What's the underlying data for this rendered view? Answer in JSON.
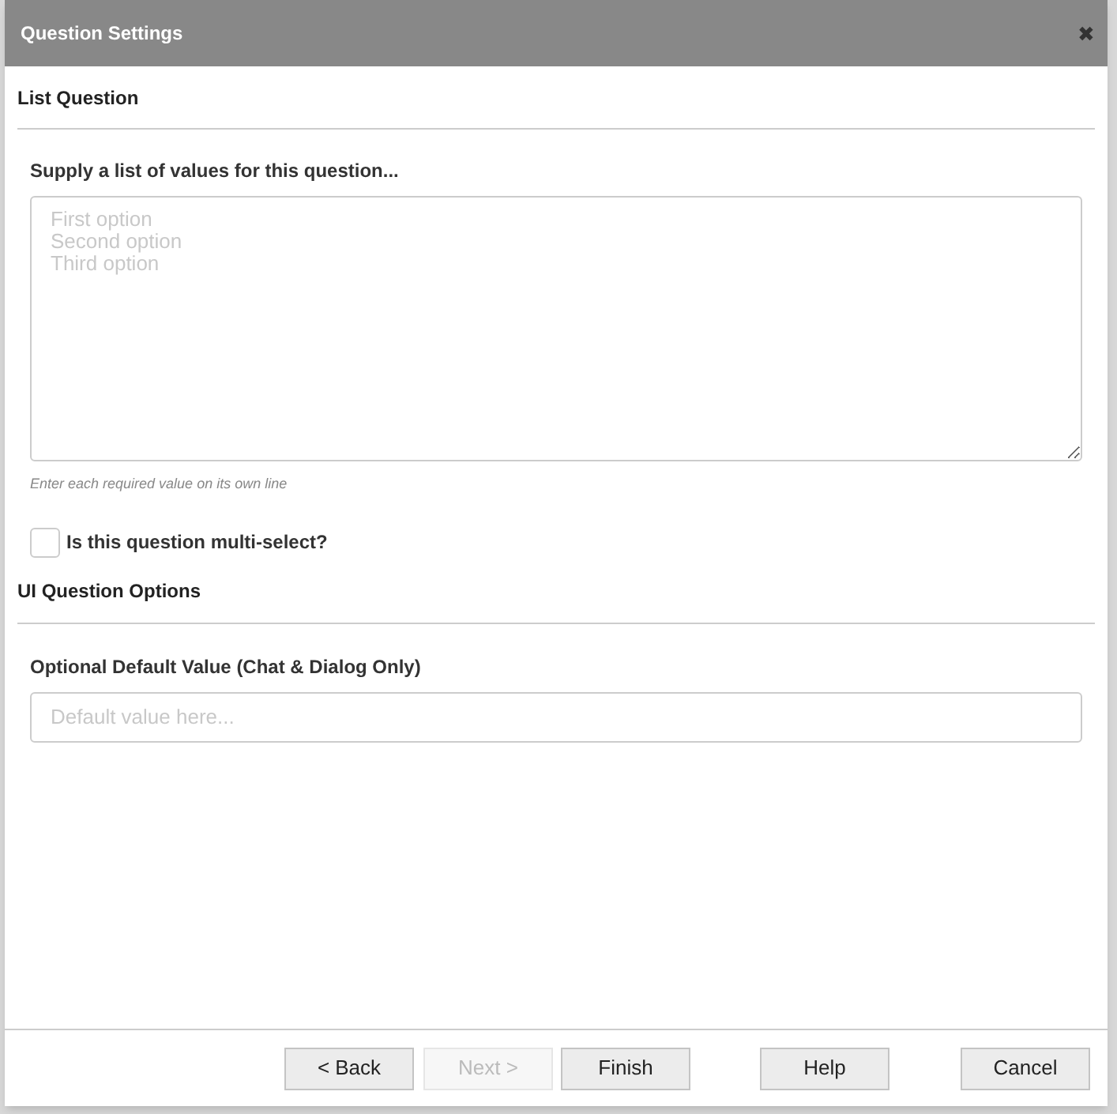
{
  "window": {
    "title": "Question Settings",
    "close": "✖"
  },
  "list_section": {
    "heading": "List Question",
    "label": "Supply a list of values for this question...",
    "values_field": {
      "placeholder": "First option\nSecond option\nThird option"
    },
    "hint": "Enter each required value on its own line",
    "multi_select": {
      "label": "Is this question multi-select?",
      "checked": false
    }
  },
  "ui_section": {
    "heading": "UI Question Options",
    "label": "Optional Default Value (Chat & Dialog Only)",
    "default_field": {
      "placeholder": "Default value here..."
    }
  },
  "buttons": [
    {
      "label": "< Back",
      "disabled": false
    },
    {
      "label": "Next >",
      "disabled": true
    },
    {
      "label": "Finish",
      "disabled": false
    },
    {
      "label": "Help",
      "disabled": false
    },
    {
      "label": "Cancel",
      "disabled": false
    }
  ]
}
